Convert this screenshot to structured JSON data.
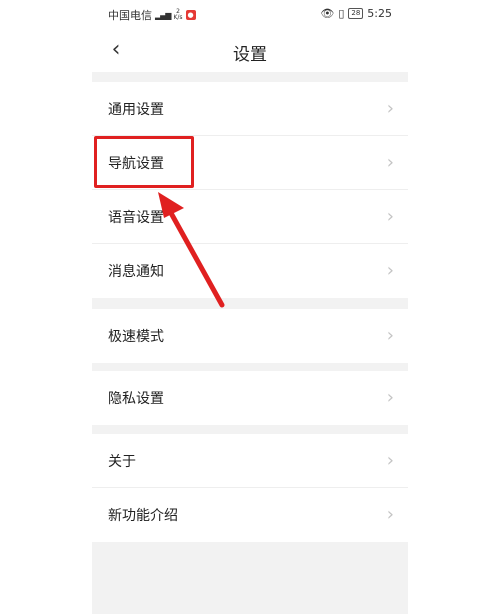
{
  "statusbar": {
    "carrier": "中国电信",
    "speed_value": "2",
    "speed_unit": "K/s",
    "battery": "28",
    "time": "5:25"
  },
  "navbar": {
    "title": "设置"
  },
  "groups": [
    {
      "items": [
        "通用设置",
        "导航设置",
        "语音设置",
        "消息通知"
      ]
    },
    {
      "items": [
        "极速模式"
      ]
    },
    {
      "items": [
        "隐私设置"
      ]
    },
    {
      "items": [
        "关于",
        "新功能介绍"
      ]
    }
  ],
  "annotation": {
    "highlight_color": "#e02020"
  }
}
